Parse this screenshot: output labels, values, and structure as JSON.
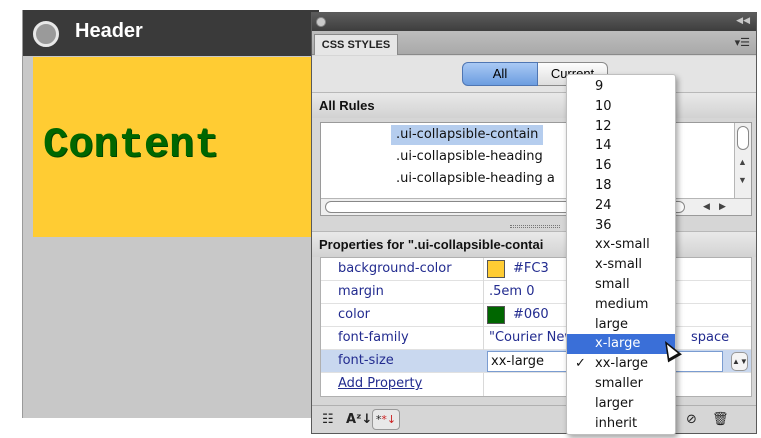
{
  "preview": {
    "header_title": "Header",
    "content_text": "Content",
    "colors": {
      "header_bg": "#3a3a3a",
      "content_bg": "#FFCC33",
      "content_text": "#006600"
    }
  },
  "panel": {
    "tab_label": "CSS STYLES",
    "mode_all": "All",
    "mode_current": "Current",
    "rules_title": "All Rules",
    "rules": [
      ".ui-collapsible-contain",
      ".ui-collapsible-heading",
      ".ui-collapsible-heading a"
    ],
    "props_title": "Properties for \".ui-collapsible-contai",
    "properties": [
      {
        "name": "background-color",
        "value": "#FC3",
        "swatch": "#FFCC33"
      },
      {
        "name": "margin",
        "value": ".5em 0"
      },
      {
        "name": "color",
        "value": "#060",
        "swatch": "#006600"
      },
      {
        "name": "font-family",
        "value": "\"Courier New",
        "value_tail": "space"
      },
      {
        "name": "font-size",
        "value": "xx-large"
      }
    ],
    "add_property": "Add Property",
    "toolbar": {
      "category_icon": "category-view-icon",
      "az_label": "A",
      "az_icon": "alphabetical-view-icon",
      "set_props_icon": "show-set-properties-icon",
      "disable_icon": "disable-icon",
      "delete_icon": "trash-icon"
    }
  },
  "dropdown": {
    "items": [
      "9",
      "10",
      "12",
      "14",
      "16",
      "18",
      "24",
      "36",
      "xx-small",
      "x-small",
      "small",
      "medium",
      "large",
      "x-large",
      "xx-large",
      "smaller",
      "larger",
      "inherit"
    ],
    "highlighted": "x-large",
    "checked": "xx-large",
    "highlight_color": "#3a6fd8"
  }
}
